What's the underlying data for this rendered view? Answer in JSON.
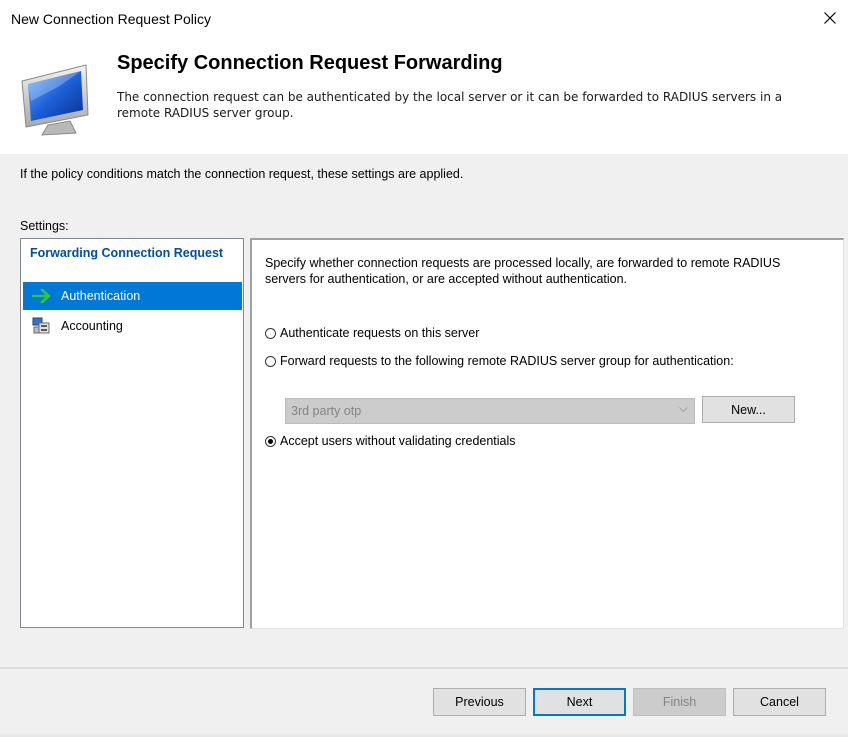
{
  "window": {
    "title": "New Connection Request Policy",
    "close_glyph": "✕"
  },
  "header": {
    "title": "Specify Connection Request Forwarding",
    "description": "The connection request can be authenticated by the local server or it can be forwarded to RADIUS servers in a remote RADIUS server group.",
    "icon": "monitor-icon"
  },
  "body": {
    "intro": "If the policy conditions match the connection request, these settings are applied.",
    "settings_label": "Settings:"
  },
  "nav": {
    "group_title": "Forwarding Connection Request",
    "items": [
      {
        "label": "Authentication",
        "icon": "green-arrow-icon",
        "selected": true
      },
      {
        "label": "Accounting",
        "icon": "servers-icon",
        "selected": false
      }
    ]
  },
  "content": {
    "description": "Specify whether connection requests are processed locally, are forwarded to remote RADIUS servers for authentication, or are accepted without authentication.",
    "options": [
      {
        "label": "Authenticate requests on this server",
        "checked": false
      },
      {
        "label": "Forward requests to the following remote RADIUS server group for authentication:",
        "checked": false
      },
      {
        "label": "Accept users without validating credentials",
        "checked": true
      }
    ],
    "server_group": {
      "value": "3rd party otp",
      "enabled": false
    },
    "new_button": "New..."
  },
  "footer": {
    "previous": "Previous",
    "next": "Next",
    "finish": "Finish",
    "cancel": "Cancel"
  },
  "colors": {
    "selection": "#0078d7",
    "group_title": "#0050a0",
    "panel_bg": "#f0f0f0"
  }
}
